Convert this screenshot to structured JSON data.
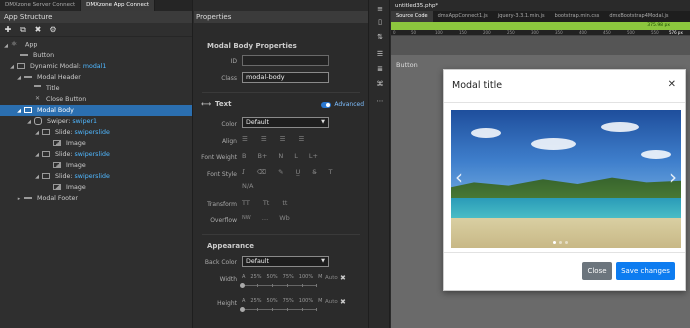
{
  "left_panel": {
    "tabs": [
      "DMXzone Server Connect",
      "DMXzone App Connect"
    ],
    "title": "App Structure",
    "tree": [
      {
        "label": "App",
        "id": ""
      },
      {
        "label": "Button",
        "id": ""
      },
      {
        "label": "Dynamic Modal:",
        "id": "modal1"
      },
      {
        "label": "Modal Header",
        "id": ""
      },
      {
        "label": "Title",
        "id": ""
      },
      {
        "label": "Close Button",
        "id": ""
      },
      {
        "label": "Modal Body",
        "id": ""
      },
      {
        "label": "Swiper:",
        "id": "swiper1"
      },
      {
        "label": "Slide:",
        "id": "swiperslide"
      },
      {
        "label": "Image",
        "id": ""
      },
      {
        "label": "Slide:",
        "id": "swiperslide"
      },
      {
        "label": "Image",
        "id": ""
      },
      {
        "label": "Slide:",
        "id": "swiperslide"
      },
      {
        "label": "Image",
        "id": ""
      },
      {
        "label": "Modal Footer",
        "id": ""
      }
    ]
  },
  "properties": {
    "title": "Properties",
    "section_title": "Modal Body Properties",
    "id_label": "ID",
    "id_value": "",
    "class_label": "Class",
    "class_value": "modal-body",
    "text_section": "Text",
    "advanced_label": "Advanced",
    "color_label": "Color",
    "color_value": "Default",
    "align_label": "Align",
    "font_weight_label": "Font Weight",
    "font_weight_options": [
      "B",
      "B+",
      "N",
      "L",
      "L+"
    ],
    "font_style_label": "Font Style",
    "font_style_na": "N/A",
    "transform_label": "Transform",
    "transform_options": [
      "TT",
      "Tt",
      "tt"
    ],
    "overflow_label": "Overflow",
    "overflow_options": [
      "NW",
      "…",
      "Wb"
    ],
    "appearance_section": "Appearance",
    "back_color_label": "Back Color",
    "back_color_value": "Default",
    "width_label": "Width",
    "height_label": "Height",
    "size_steps": [
      "A",
      "25%",
      "50%",
      "75%",
      "100%",
      "M"
    ],
    "auto_label": "Auto"
  },
  "editor": {
    "document_tab": "untitled35.php*",
    "file_tabs": [
      "Source Code",
      "dmxAppConnect1.js",
      "jquery-3.3.1.min.js",
      "bootstrap.min.css",
      "dmxBootstrap4Modal.js"
    ],
    "greenbar_text": "375.98 px",
    "ruler_labels": [
      "0",
      "50",
      "100",
      "150",
      "200",
      "250",
      "300",
      "350",
      "400",
      "450",
      "500",
      "550"
    ],
    "ruler_right": "576 px",
    "design_button": "Button",
    "modal_title": "Modal title",
    "close_button": "Close",
    "save_button": "Save changes"
  }
}
